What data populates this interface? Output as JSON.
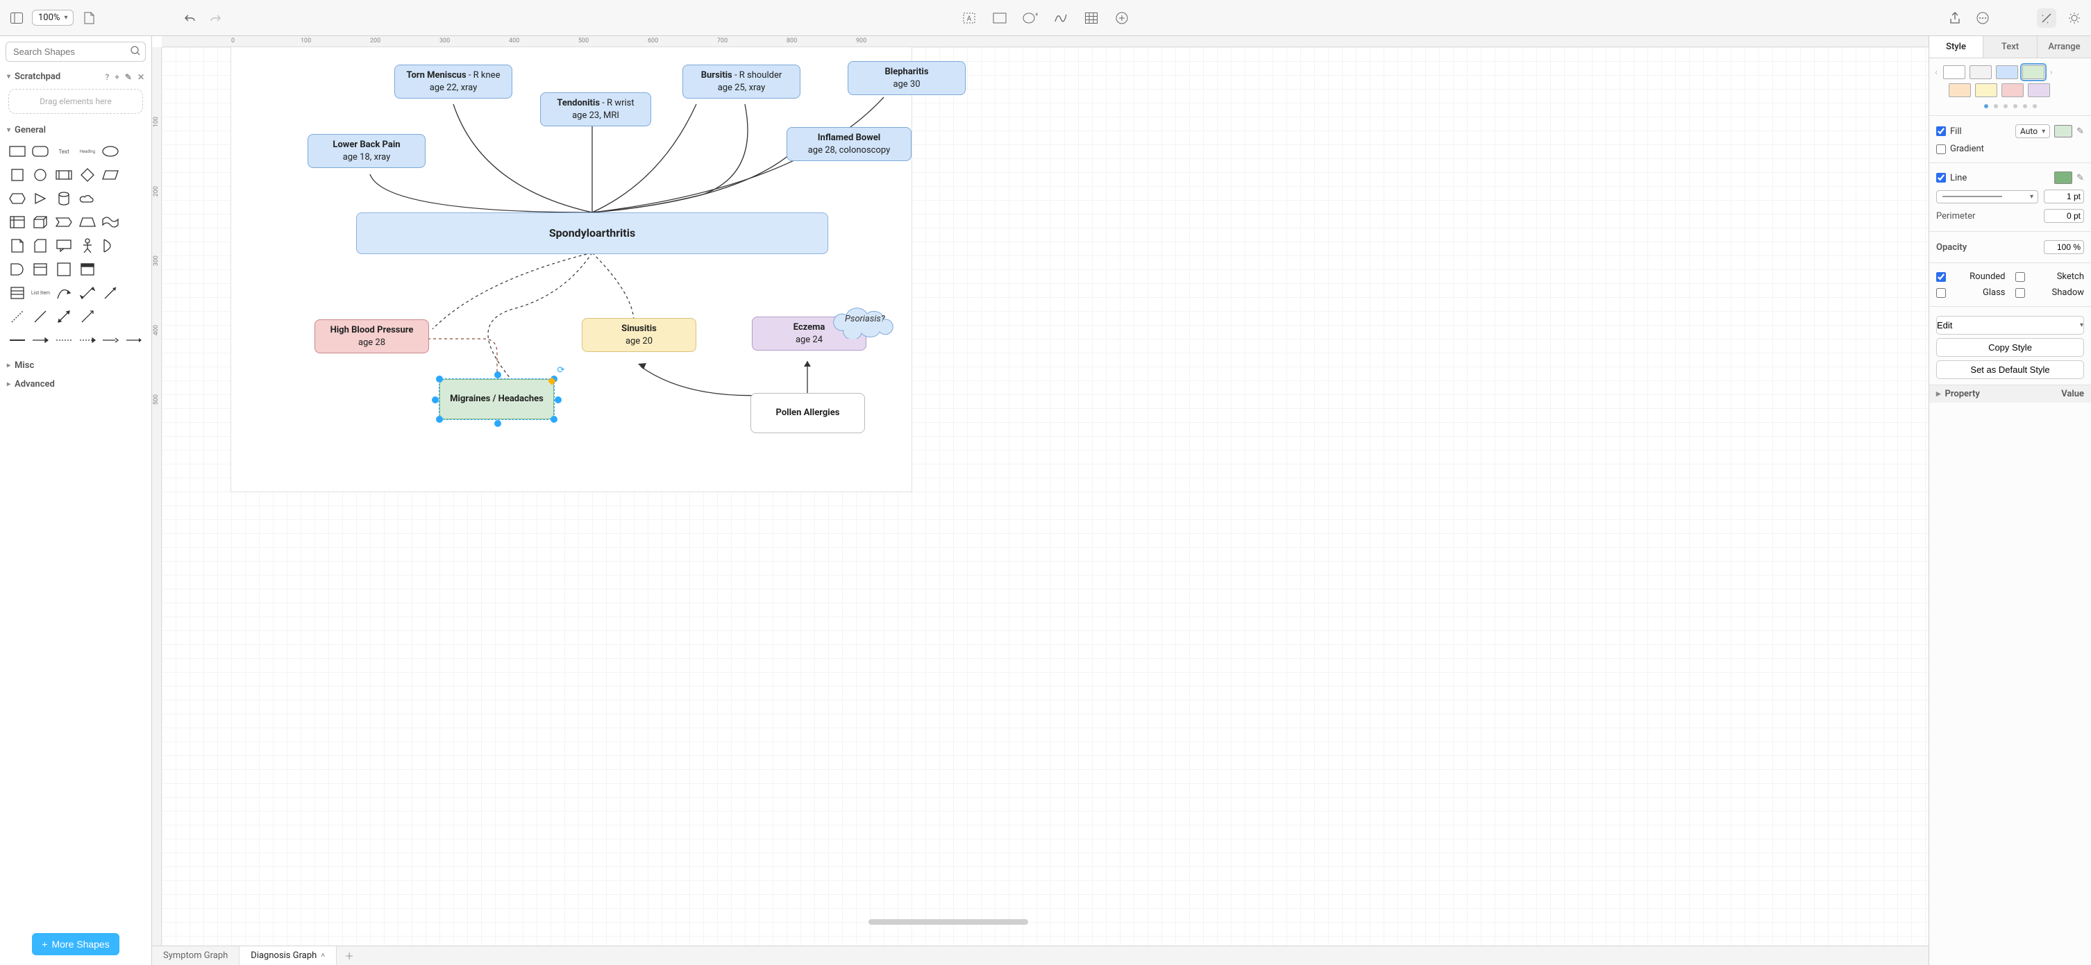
{
  "toolbar": {
    "zoom": "100%"
  },
  "left": {
    "search_placeholder": "Search Shapes",
    "scratchpad": {
      "title": "Scratchpad",
      "drop": "Drag elements here"
    },
    "general": "General",
    "shape_text": "Text",
    "shape_heading": "Heading",
    "shape_listitem": "List Item",
    "misc": "Misc",
    "advanced": "Advanced",
    "more": "More Shapes"
  },
  "tabs": {
    "t1": "Symptom Graph",
    "t2": "Diagnosis Graph"
  },
  "ruler": {
    "h": [
      "0",
      "100",
      "200",
      "300",
      "400",
      "500",
      "600",
      "700",
      "800",
      "900"
    ],
    "v": [
      "100",
      "200",
      "300",
      "400",
      "500"
    ]
  },
  "nodes": {
    "lbp": {
      "t": "Lower Back Pain",
      "s": "age 18, xray"
    },
    "meniscus": {
      "t": "Torn Meniscus",
      "s": " - R knee",
      "s2": "age 22, xray"
    },
    "tendon": {
      "t": "Tendonitis",
      "s": " - R wrist",
      "s2": "age 23, MRI"
    },
    "bursitis": {
      "t": "Bursitis",
      "s": " - R shoulder",
      "s2": "age 25, xray"
    },
    "bowel": {
      "t": "Inflamed Bowel",
      "s": "age 28, colonoscopy"
    },
    "bleph": {
      "t": "Blepharitis",
      "s": "age 30"
    },
    "spondy": {
      "t": "Spondyloarthritis"
    },
    "hbp": {
      "t": "High Blood Pressure",
      "s": "age 28"
    },
    "migraine": {
      "t": "Migraines / Headaches"
    },
    "sinus": {
      "t": "Sinusitis",
      "s": "age 20"
    },
    "eczema": {
      "t": "Eczema",
      "s": "age 24"
    },
    "pollen": {
      "t": "Pollen Allergies"
    },
    "psor": {
      "t": "Psoriasis?"
    }
  },
  "right": {
    "tabs": {
      "style": "Style",
      "text": "Text",
      "arrange": "Arrange"
    },
    "fill": "Fill",
    "fill_mode": "Auto",
    "gradient": "Gradient",
    "line": "Line",
    "line_pt": "1 pt",
    "perimeter": "Perimeter",
    "perimeter_pt": "0 pt",
    "opacity": "Opacity",
    "opacity_val": "100 %",
    "rounded": "Rounded",
    "sketch": "Sketch",
    "glass": "Glass",
    "shadow": "Shadow",
    "edit": "Edit",
    "copy": "Copy Style",
    "setdef": "Set as Default Style",
    "property": "Property",
    "value": "Value",
    "colors": {
      "fill": "#d7ead7",
      "line": "#7fb47f"
    },
    "swatches1": [
      "#ffffff",
      "#f2f2f2",
      "#cfe2fb",
      "#d8ecd4"
    ],
    "swatches2": [
      "#fde3c4",
      "#fcf3c7",
      "#f6cfcf",
      "#e6d9ef"
    ]
  }
}
